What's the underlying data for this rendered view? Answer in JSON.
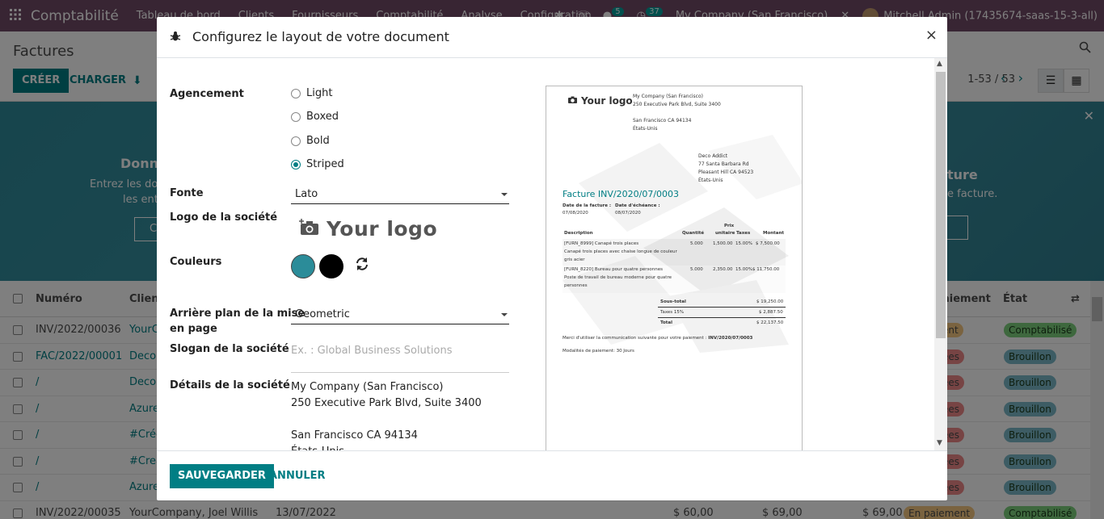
{
  "navbar": {
    "brand": "Comptabilité",
    "menu": [
      "Tableau de bord",
      "Clients",
      "Fournisseurs",
      "Comptabilité",
      "Analyse",
      "Configuration"
    ],
    "badge_chat": "5",
    "badge_activity": "37",
    "company": "My Company (San Francisco)",
    "user": "Mitchell Admin (17435674-saas-15-3-all)"
  },
  "control_panel": {
    "title": "Factures",
    "create_label": "CRÉER",
    "load_label": "CHARGER",
    "pager": "1-53 / 53"
  },
  "banner": {
    "left_title": "Donné",
    "left_text1": "Entrez les don",
    "left_text2": "les enté",
    "left_button": "C",
    "right_title": "ture",
    "right_text": "e facture."
  },
  "table": {
    "headers": {
      "number": "Numéro",
      "client": "Client",
      "payment": "aiement",
      "state": "État"
    },
    "rows": [
      {
        "number": "INV/2022/00036",
        "client": "YourC",
        "payment": "ent",
        "state": "Comptabilisé",
        "payment_color": "#f4c780",
        "state_color": "#7dd17d",
        "link": false
      },
      {
        "number": "FAC/2022/00001",
        "client": "Deco",
        "payment": "ées",
        "state": "Brouillon",
        "payment_color": "#ee8888",
        "state_color": "#7ab8c9",
        "link": true
      },
      {
        "number": "/",
        "client": "Deco",
        "payment": "ées",
        "state": "Brouillon",
        "payment_color": "#ee8888",
        "state_color": "#7ab8c9",
        "link": true
      },
      {
        "number": "/",
        "client": "Azure",
        "payment": "ées",
        "state": "Brouillon",
        "payment_color": "#ee8888",
        "state_color": "#7ab8c9",
        "link": true
      },
      {
        "number": "/",
        "client": "#Créé",
        "payment": "ées",
        "state": "Brouillon",
        "payment_color": "#ee8888",
        "state_color": "#7ab8c9",
        "link": true
      },
      {
        "number": "/",
        "client": "#Crea",
        "payment": "ées",
        "state": "Brouillon",
        "payment_color": "#ee8888",
        "state_color": "#7ab8c9",
        "link": true
      },
      {
        "number": "/",
        "client": "Azure",
        "payment": "ées",
        "state": "Brouillon",
        "payment_color": "#ee8888",
        "state_color": "#7ab8c9",
        "link": true
      }
    ],
    "last_row": {
      "number": "INV/2022/00035",
      "client": "YourCompany, Joel Willis",
      "date": "13/07/2022",
      "amount1": "$ 60,00",
      "amount2": "$ 69,00",
      "amount3": "$ 69,00",
      "payment": "En paiement",
      "state": "Comptabilisé"
    }
  },
  "modal": {
    "title": "Configurez le layout de votre document",
    "labels": {
      "layout": "Agencement",
      "font": "Fonte",
      "logo": "Logo de la société",
      "colors": "Couleurs",
      "background_line1": "Arrière plan de la mise",
      "background_line2": "en page",
      "slogan": "Slogan de la société",
      "details": "Détails de la société"
    },
    "layout_options": [
      "Light",
      "Boxed",
      "Bold",
      "Striped"
    ],
    "layout_selected": "Striped",
    "font_value": "Lato",
    "logo_text": "Your logo",
    "primary_color": "#2b8c99",
    "secondary_color": "#000000",
    "background_value": "Geometric",
    "slogan_placeholder": "Ex. : Global Business Solutions",
    "company_details": [
      "My Company (San Francisco)",
      "250 Executive Park Blvd, Suite 3400",
      "",
      "San Francisco CA 94134",
      "États-Unis"
    ],
    "save_label": "SAUVEGARDER",
    "cancel_label": "ANNULER"
  },
  "preview": {
    "logo_text": "Your logo",
    "company_lines": [
      "My Company (San Francisco)",
      "250 Executive Park Blvd, Suite 3400",
      "",
      "San Francisco CA 94134",
      "États-Unis"
    ],
    "partner_lines": [
      "Deco Addict",
      "77 Santa Barbara Rd",
      "Pleasant Hill CA 94523",
      "États-Unis"
    ],
    "invoice_title": "Facture INV/2020/07/0003",
    "date_invoice_label": "Date de la facture :",
    "date_invoice": "07/08/2020",
    "date_due_label": "Date d'échéance :",
    "date_due": "08/07/2020",
    "col_description": "Description",
    "col_qty": "Quantité",
    "col_price_line1": "Prix",
    "col_price_line2": "unitaire",
    "col_taxes": "Taxes",
    "col_amount": "Montant",
    "line1": [
      "[FURN_8999] Canapé trois places",
      "Canapé trois places avec chaise longue de couleur",
      "gris acier"
    ],
    "line1_qty": "5.000",
    "line1_price": "1,500.00",
    "line1_tax": "15.00%",
    "line1_amount": "$ 7,500.00",
    "line2": [
      "[FURN_8220] Bureau pour quatre personnes",
      "Poste de travail de bureau moderne pour quatre",
      "personnes"
    ],
    "line2_qty": "5.000",
    "line2_price": "2,350.00",
    "line2_tax": "15.00%",
    "line2_amount": "$ 11,750.00",
    "subtotal_label": "Sous-total",
    "subtotal": "$ 19,250.00",
    "tax_label": "Taxes 15%",
    "tax": "$ 2,887.50",
    "total_label": "Total",
    "total": "$ 22,137.50",
    "comm_text": "Merci d'utiliser la communication suivante pour votre paiement :",
    "comm_ref": "INV/2020/07/0003",
    "terms": "Modalités de paiement: 30 Jours"
  }
}
